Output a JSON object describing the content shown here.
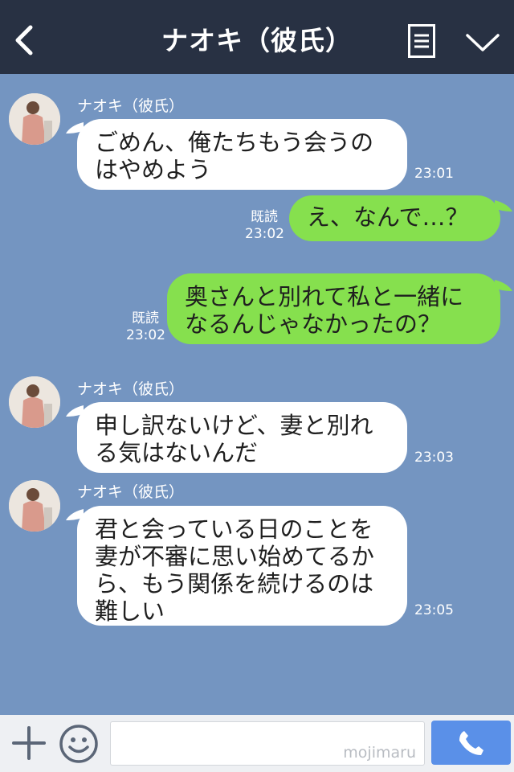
{
  "header": {
    "title": "ナオキ（彼氏）"
  },
  "messages": [
    {
      "sender": "ナオキ（彼氏）",
      "text": "ごめん、俺たちもう会うの\nはやめよう",
      "time": "23:01"
    },
    {
      "text": "え、なんで…？",
      "read": "既読",
      "time": "23:02"
    },
    {
      "text": "奥さんと別れて私と一緒に\nなるんじゃなかったの？",
      "read": "既読",
      "time": "23:02"
    },
    {
      "sender": "ナオキ（彼氏）",
      "text": "申し訳ないけど、妻と別れ\nる気はないんだ",
      "time": "23:03"
    },
    {
      "sender": "ナオキ（彼氏）",
      "text": "君と会っている日のことを\n妻が不審に思い始めてるか\nら、もう関係を続けるのは\n難しい",
      "time": "23:05"
    }
  ],
  "input": {
    "watermark": "mojimaru"
  },
  "colors": {
    "header": "#283143",
    "background": "#7495c1",
    "my_bubble": "#86e04e",
    "call_button": "#5a90e8"
  }
}
